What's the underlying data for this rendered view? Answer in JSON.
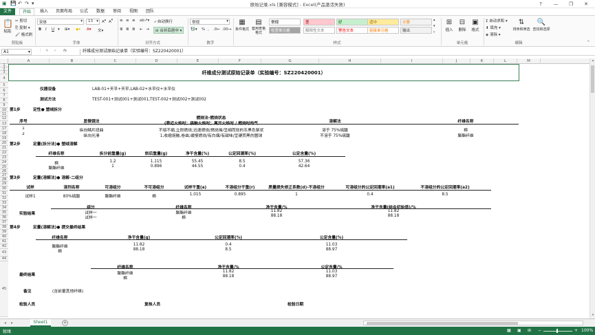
{
  "window": {
    "title": "原始记录.xls  [兼容模式] - Excel(产品激活失败)",
    "controls": [
      "?",
      "—",
      "❐",
      "✕"
    ]
  },
  "menu": {
    "tabs": [
      "文件",
      "开始",
      "插入",
      "页面布局",
      "公式",
      "数据",
      "审阅",
      "视图",
      "团队"
    ],
    "active": "开始"
  },
  "ribbon": {
    "clipboard": {
      "paste": "粘贴",
      "cut": "剪切",
      "copy": "复制",
      "format_painter": "格式刷",
      "label": "剪贴板"
    },
    "font": {
      "name": "宋体",
      "size": "13",
      "label": "字体",
      "bold": "B",
      "italic": "I",
      "underline": "U"
    },
    "alignment": {
      "wrap": "自动换行",
      "merge": "合并后居中",
      "label": "对齐方式"
    },
    "number": {
      "format": "常规",
      "label": "数字",
      "percent": "%",
      "comma": ","
    },
    "styles": {
      "conditional": "条件格式",
      "table": "套用表格格式",
      "cells": [
        {
          "label": "常规",
          "bg": "#ffffff",
          "fg": "#000000"
        },
        {
          "label": "差",
          "bg": "#ffc7ce",
          "fg": "#9c0006"
        },
        {
          "label": "好",
          "bg": "#c6efce",
          "fg": "#006100"
        },
        {
          "label": "适中",
          "bg": "#ffeb9c",
          "fg": "#9c6500"
        },
        {
          "label": "计算",
          "bg": "#f2f2f2",
          "fg": "#fa7d00"
        },
        {
          "label": "检查单元格",
          "bg": "#a5a5a5",
          "fg": "#ffffff"
        },
        {
          "label": "解释性文本",
          "bg": "#ffffff",
          "fg": "#7f7f7f"
        },
        {
          "label": "警告文本",
          "bg": "#ffffff",
          "fg": "#ff0000"
        },
        {
          "label": "链接单元格",
          "bg": "#ffffff",
          "fg": "#fa7d00"
        },
        {
          "label": "输出",
          "bg": "#f2f2f2",
          "fg": "#3f3f3f"
        }
      ],
      "label": "样式"
    },
    "cells_group": {
      "insert": "插入",
      "delete": "删除",
      "format": "格式",
      "label": "单元格"
    },
    "editing": {
      "autosum": "自动求和",
      "fill": "填充",
      "clear": "清除",
      "sort": "排序和筛选",
      "find": "查找和选择",
      "label": "编辑"
    }
  },
  "formula_bar": {
    "name_box": "A1",
    "fx": "fx",
    "content": "纤维成分测试原始记录单（实验编号：SZ220420001）"
  },
  "columns": [
    "A",
    "B",
    "C",
    "D",
    "E",
    "F",
    "G",
    "H",
    "I",
    "J",
    "K",
    "L",
    "M"
  ],
  "rows": [
    "1",
    "2",
    "3",
    "4",
    "5",
    "6",
    "7",
    "8",
    "9",
    "10",
    "11",
    "12",
    "13",
    "17",
    "18",
    "19",
    "20",
    "21",
    "22",
    "23",
    "24",
    "25",
    "26",
    "27",
    "28",
    "29",
    "30",
    "31",
    "32",
    "33",
    "34",
    "35",
    "36",
    "37",
    "38",
    "39",
    "40",
    "41",
    "42",
    "43",
    "44",
    "45"
  ],
  "sheet": {
    "title": "纤维成分测试原始记录单（实验编号：SZ220420001）",
    "instrument_label": "仪器设备",
    "instrument_value": "LAB-01+天平+天平,LAB-02+水平仪+水平仪",
    "method_label": "测试方法",
    "method_value": "TEST-001+测试001+测试001,TEST-002+测试002+测试002",
    "step1": {
      "label": "第1步",
      "title": "定性●  塑绒拆分",
      "headers": [
        "序号",
        "显微镜法",
        "燃烧法-燃烧状态",
        "溶解法",
        "纤维名称"
      ],
      "burn_sub": "(靠近火焰时；接触火焰时；离开火焰时  /  燃烧时的气",
      "rows": [
        [
          "1",
          "纵向鳞片扭曲",
          "不熔不缩,立即燃烧;迅速燃烧/燃烧烽/呈细而软的灰黑色絮状",
          "溶于 75%硫酸",
          "棉"
        ],
        [
          "2",
          "纵向光滑",
          "1,收缩熔融,卷曲;缓慢燃烧/有白烟/有甜味/呈硬而黑的圆球",
          "不溶于 75%硫酸",
          "聚酯纤维"
        ]
      ]
    },
    "step2": {
      "label": "第2步",
      "title": "定量(拆分法)●  塑绒溶解",
      "headers": [
        "纤维名称",
        "拆分前重量(g)",
        "烘后重量(g)",
        "净干含量(%)",
        "公定回潮率(%)",
        "公定含量(%)"
      ],
      "rows": [
        [
          "棉",
          "1.2",
          "1.115",
          "55.45",
          "8.5",
          "57.36"
        ],
        [
          "聚酯纤维",
          "1",
          "0.896",
          "44.55",
          "0.4",
          "42.64"
        ]
      ]
    },
    "step3": {
      "label": "第3步",
      "title": "定量(溶解法)●  溶解-二组分",
      "headers": [
        "试样",
        "溶剂名称",
        "可溶组分",
        "不可溶组分",
        "试样干重(a)",
        "不溶组分干重(r)",
        "质量损失修正系数(d)-不溶组分",
        "可溶组分的公定回潮率(a1)",
        "不溶组分的公定回潮率(a2)"
      ],
      "row": [
        "试样1",
        "80%硫酸",
        "聚酯纤维",
        "棉",
        "1.015",
        "0.895",
        "1",
        "0.4",
        "8.5"
      ],
      "result_label": "实验结果",
      "result_headers": [
        "组分",
        "纤维名称",
        "净干含量/%",
        "净干含量(结合初始值)/%"
      ],
      "result_rows": [
        [
          "试样一",
          "聚酯纤维",
          "11.82",
          "11.82"
        ],
        [
          "试样一",
          "棉",
          "88.18",
          "88.18"
        ]
      ]
    },
    "step4": {
      "label": "第4步",
      "title": "定量(溶解法)●  提交最终结果",
      "headers": [
        "纤维名称",
        "净干含量(g)",
        "公定回潮率(%)",
        "公定含量(%)"
      ],
      "rows": [
        [
          "聚酯纤维",
          "11.82",
          "0.4",
          "11.03"
        ],
        [
          "棉",
          "88.18",
          "8.5",
          "88.97"
        ]
      ],
      "final_label": "最终结果",
      "final_headers": [
        "纤维名称",
        "净干含量/%",
        "公定含量/%"
      ],
      "final_rows": [
        [
          "聚酯纤维",
          "11.82",
          "11.03"
        ],
        [
          "棉",
          "88.18",
          "88.97"
        ]
      ]
    },
    "notes_label": "备注",
    "notes_value": "(含前量其他纤维)",
    "inspector_label": "检验人员",
    "reviewer_label": "复核人员",
    "date_label": "检验日期"
  },
  "sheet_tabs": [
    "Sheet1"
  ],
  "status": {
    "ready": "就绪",
    "zoom": "100%"
  }
}
